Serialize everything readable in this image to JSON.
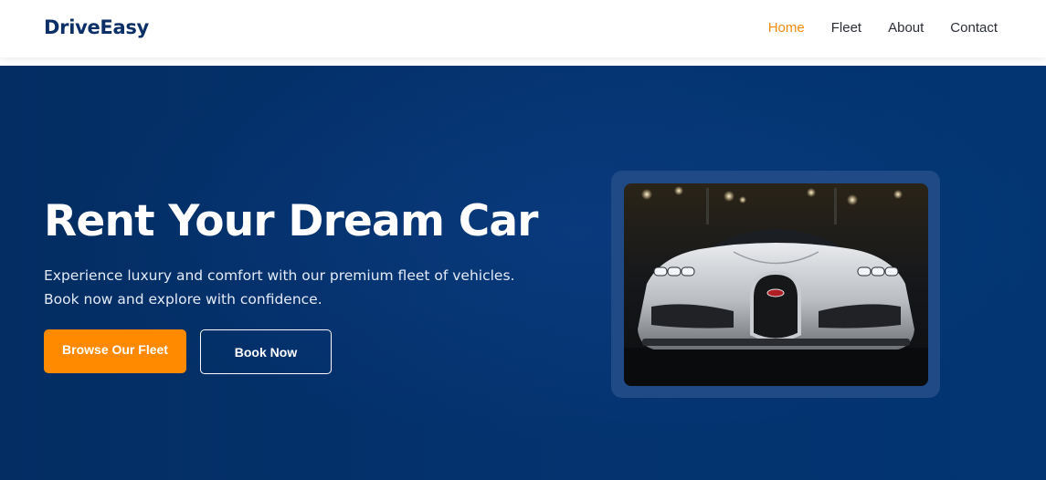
{
  "brand": {
    "name": "DriveEasy"
  },
  "nav": {
    "items": [
      {
        "label": "Home",
        "active": true
      },
      {
        "label": "Fleet",
        "active": false
      },
      {
        "label": "About",
        "active": false
      },
      {
        "label": "Contact",
        "active": false
      }
    ]
  },
  "hero": {
    "title": "Rent Your Dream Car",
    "subtitle_line1": "Experience luxury and comfort with our premium fleet of vehicles.",
    "subtitle_line2": "Book now and explore with confidence.",
    "primary_button": "Browse Our Fleet",
    "secondary_button": "Book Now",
    "image": {
      "subject": "silver sports car front view at night"
    }
  },
  "colors": {
    "brand_text": "#0b2f66",
    "accent": "#ff8a00",
    "nav_active": "#f28c0f",
    "hero_background": "#04336f"
  }
}
